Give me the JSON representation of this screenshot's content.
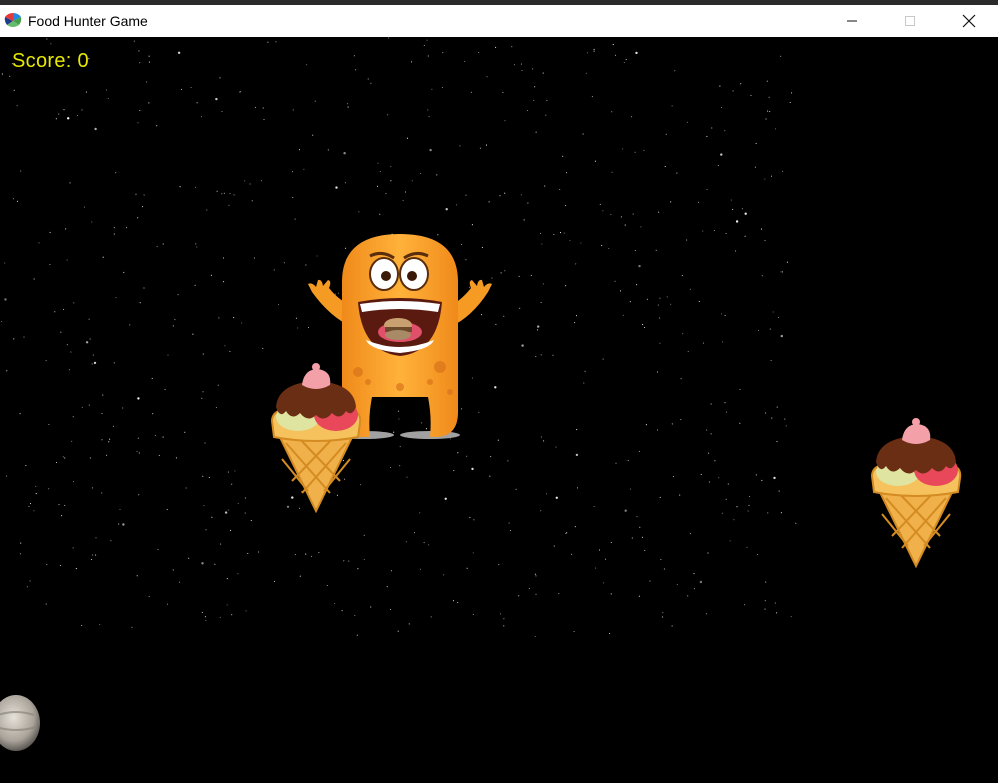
{
  "window": {
    "title": "Food Hunter Game",
    "icons": {
      "app": "color-wheel-icon",
      "minimize": "minimize-icon",
      "maximize": "maximize-icon",
      "close": "close-icon"
    }
  },
  "game": {
    "score_text": "Score: 0",
    "score_color": "#e8e800",
    "background_color": "#000000",
    "sprites": [
      "monster-player",
      "ice-cream-cone",
      "ice-cream-cone",
      "planet"
    ]
  }
}
